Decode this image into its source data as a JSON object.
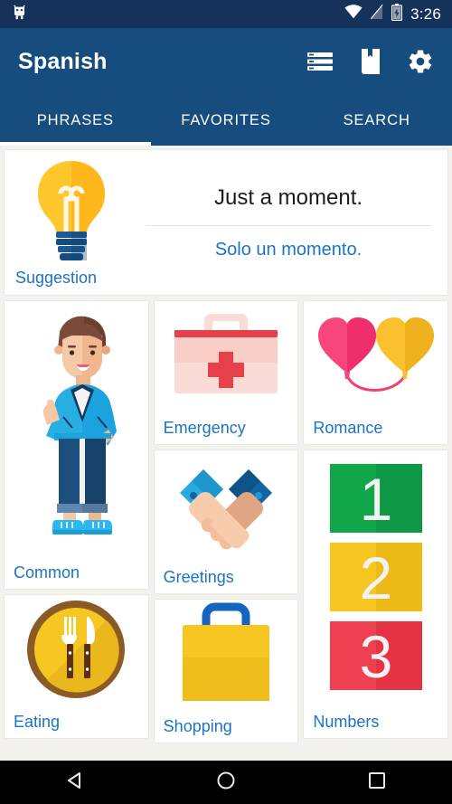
{
  "statusbar": {
    "time": "3:26",
    "icons": [
      "android-robot-icon",
      "wifi-icon",
      "cell-signal-icon",
      "battery-charging-icon"
    ]
  },
  "appbar": {
    "title": "Spanish",
    "actions": [
      {
        "name": "lessons-list-icon",
        "label": "Lessons"
      },
      {
        "name": "book-bookmark-icon",
        "label": "Book"
      },
      {
        "name": "settings-gear-icon",
        "label": "Settings"
      }
    ]
  },
  "tabs": [
    {
      "label": "PHRASES",
      "active": true
    },
    {
      "label": "FAVORITES",
      "active": false
    },
    {
      "label": "SEARCH",
      "active": false
    }
  ],
  "suggestion": {
    "label": "Suggestion",
    "english": "Just a moment.",
    "spanish": "Solo un momento.",
    "icon": "lightbulb-icon"
  },
  "categories": [
    {
      "label": "Common",
      "icon": "person-pointing-up-icon"
    },
    {
      "label": "Emergency",
      "icon": "first-aid-kit-icon"
    },
    {
      "label": "Romance",
      "icon": "heart-balloons-icon"
    },
    {
      "label": "Greetings",
      "icon": "handshake-icon"
    },
    {
      "label": "Numbers",
      "icon": "number-blocks-icon"
    },
    {
      "label": "Eating",
      "icon": "plate-fork-knife-icon"
    },
    {
      "label": "Shopping",
      "icon": "shopping-bag-icon"
    }
  ],
  "navbar": [
    {
      "name": "nav-back-button",
      "glyph": "back-triangle-icon"
    },
    {
      "name": "nav-home-button",
      "glyph": "home-circle-icon"
    },
    {
      "name": "nav-recents-button",
      "glyph": "recents-square-icon"
    }
  ],
  "colors": {
    "status_bar": "#15325B",
    "app_bar": "#164C7E",
    "accent_link": "#1A73C4",
    "page_background": "#F2F1ED",
    "number_one": "#12A64A",
    "number_two": "#F6C222",
    "number_three": "#EE4050"
  }
}
